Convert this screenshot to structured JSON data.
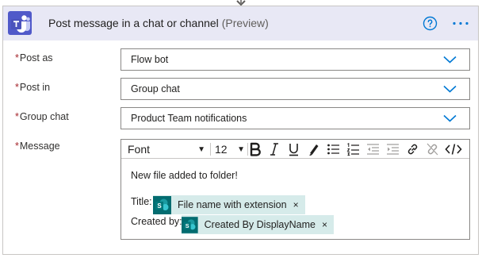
{
  "action": {
    "title": "Post message in a chat or channel",
    "preview_tag": "(Preview)",
    "icons": {
      "logo": "microsoft-teams-icon",
      "help": "help-icon",
      "more": "more-options-icon"
    },
    "colors": {
      "header_bg": "#e8e8f5",
      "accent": "#0078d4",
      "teams_purple": "#5059c9",
      "token_bg": "#d6ebea",
      "required": "#a4262c"
    }
  },
  "fields": {
    "post_as": {
      "label": "Post as",
      "value": "Flow bot"
    },
    "post_in": {
      "label": "Post in",
      "value": "Group chat"
    },
    "group_chat": {
      "label": "Group chat",
      "value": "Product Team notifications"
    },
    "message": {
      "label": "Message"
    }
  },
  "required_marker": "*",
  "toolbar": {
    "font": "Font",
    "size": "12",
    "buttons": [
      "bold",
      "italic",
      "underline",
      "highlight",
      "bulleted-list",
      "numbered-list",
      "decrease-indent",
      "increase-indent",
      "insert-link",
      "remove-link",
      "code-view"
    ]
  },
  "message": {
    "body": "New file added to folder!",
    "lines": [
      {
        "label": "Title:",
        "token": "File name with extension",
        "close": "×"
      },
      {
        "label": "Created by:",
        "token": "Created By DisplayName",
        "close": "×"
      }
    ]
  }
}
